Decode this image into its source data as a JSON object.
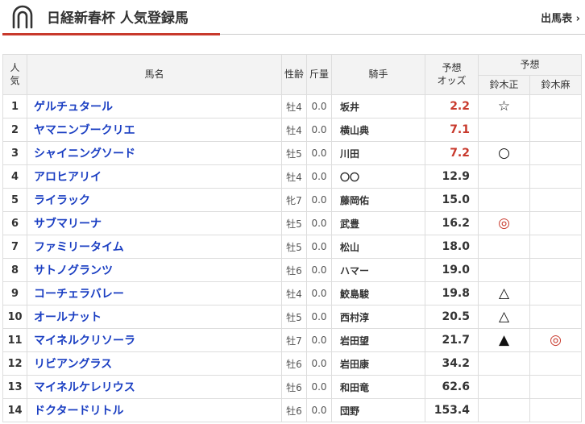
{
  "header": {
    "title": "日経新春杯 人気登録馬",
    "nav_link": "出馬表 ›"
  },
  "table": {
    "col_rank": [
      "人",
      "気"
    ],
    "col_name": "馬名",
    "col_sex_age": "性齢",
    "col_weight": "斤量",
    "col_jockey": "騎手",
    "col_odds": [
      "予想",
      "オッズ"
    ],
    "col_pred_group": "予想",
    "predictors": [
      "鈴木正",
      "鈴木麻"
    ]
  },
  "rows": [
    {
      "rank": "1",
      "name": "ゲルチュタール",
      "sex_age": "牡4",
      "weight": "0.0",
      "jockey": "坂井",
      "odds": "2.2",
      "top": true,
      "mark1": "☆",
      "mark2": ""
    },
    {
      "rank": "2",
      "name": "ヤマニンブークリエ",
      "sex_age": "牡4",
      "weight": "0.0",
      "jockey": "横山典",
      "odds": "7.1",
      "top": true,
      "mark1": "",
      "mark2": ""
    },
    {
      "rank": "3",
      "name": "シャイニングソード",
      "sex_age": "牡5",
      "weight": "0.0",
      "jockey": "川田",
      "odds": "7.2",
      "top": true,
      "mark1": "○",
      "mark2": ""
    },
    {
      "rank": "4",
      "name": "アロヒアリイ",
      "sex_age": "牡4",
      "weight": "0.0",
      "jockey": "〇〇",
      "odds": "12.9",
      "top": false,
      "mark1": "",
      "mark2": ""
    },
    {
      "rank": "5",
      "name": "ライラック",
      "sex_age": "牝7",
      "weight": "0.0",
      "jockey": "藤岡佑",
      "odds": "15.0",
      "top": false,
      "mark1": "",
      "mark2": ""
    },
    {
      "rank": "6",
      "name": "サブマリーナ",
      "sex_age": "牡5",
      "weight": "0.0",
      "jockey": "武豊",
      "odds": "16.2",
      "top": false,
      "mark1": "◎",
      "mark2": ""
    },
    {
      "rank": "7",
      "name": "ファミリータイム",
      "sex_age": "牡5",
      "weight": "0.0",
      "jockey": "松山",
      "odds": "18.0",
      "top": false,
      "mark1": "",
      "mark2": ""
    },
    {
      "rank": "8",
      "name": "サトノグランツ",
      "sex_age": "牡6",
      "weight": "0.0",
      "jockey": "ハマー",
      "odds": "19.0",
      "top": false,
      "mark1": "",
      "mark2": ""
    },
    {
      "rank": "9",
      "name": "コーチェラバレー",
      "sex_age": "牡4",
      "weight": "0.0",
      "jockey": "鮫島駿",
      "odds": "19.8",
      "top": false,
      "mark1": "△",
      "mark2": ""
    },
    {
      "rank": "10",
      "name": "オールナット",
      "sex_age": "牡5",
      "weight": "0.0",
      "jockey": "西村淳",
      "odds": "20.5",
      "top": false,
      "mark1": "△",
      "mark2": ""
    },
    {
      "rank": "11",
      "name": "マイネルクリソーラ",
      "sex_age": "牡7",
      "weight": "0.0",
      "jockey": "岩田望",
      "odds": "21.7",
      "top": false,
      "mark1": "▲",
      "mark2": "◎"
    },
    {
      "rank": "12",
      "name": "リビアングラス",
      "sex_age": "牡6",
      "weight": "0.0",
      "jockey": "岩田康",
      "odds": "34.2",
      "top": false,
      "mark1": "",
      "mark2": ""
    },
    {
      "rank": "13",
      "name": "マイネルケレリウス",
      "sex_age": "牡6",
      "weight": "0.0",
      "jockey": "和田竜",
      "odds": "62.6",
      "top": false,
      "mark1": "",
      "mark2": ""
    },
    {
      "rank": "14",
      "name": "ドクタードリトル",
      "sex_age": "牡6",
      "weight": "0.0",
      "jockey": "団野",
      "odds": "153.4",
      "top": false,
      "mark1": "",
      "mark2": ""
    }
  ],
  "colors": {
    "accent": "#c8392c",
    "link": "#1a3ec2",
    "header_bg": "#f3f3f3",
    "border": "#dddddd"
  },
  "icons": {
    "logo": "horseshoe-icon",
    "nav": "chevron-right-icon"
  }
}
